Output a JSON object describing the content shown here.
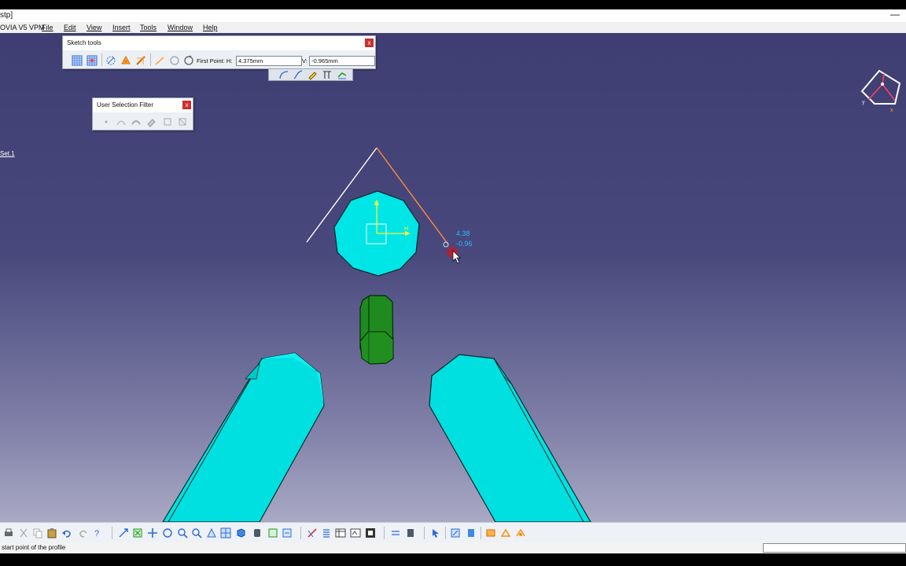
{
  "window": {
    "title_fragment": "stp]",
    "minimize": "—"
  },
  "menu": {
    "app_fragment": "OVIA V5 VPM",
    "items": [
      {
        "label": "File"
      },
      {
        "label": "Edit"
      },
      {
        "label": "View"
      },
      {
        "label": "Insert"
      },
      {
        "label": "Tools"
      },
      {
        "label": "Window"
      },
      {
        "label": "Help"
      }
    ]
  },
  "sketch_tools": {
    "title": "Sketch tools",
    "close": "x",
    "first_point_label": "First Point: H:",
    "h_value": "4.375mm",
    "v_label": "V:",
    "v_value": "-0.965mm"
  },
  "selection_filter": {
    "title": "User Selection Filter",
    "close": "x"
  },
  "tree": {
    "node_fragment": "Set.1"
  },
  "cursor_readout": {
    "h": "4.38",
    "v": "-0.96"
  },
  "sketch_axes": {
    "v": "V",
    "h": "H"
  },
  "compass": {
    "y": "y",
    "x": "x"
  },
  "status": {
    "message": "start point of the profile"
  },
  "colors": {
    "part_cyan": "#00e5e5",
    "rod_green": "#1f8a1f",
    "axis_yellow": "#ffff33",
    "rubber_band": "#ff8c3a",
    "readout_blue": "#35b6ff"
  }
}
